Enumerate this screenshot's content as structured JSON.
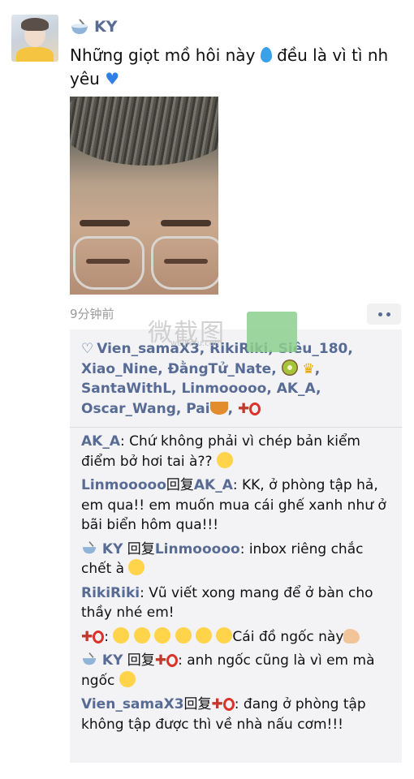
{
  "post": {
    "author": "KY",
    "text_before_drop": "Những giọt mồ hôi này ",
    "text_after_drop": " đều là vì tì nh yêu ",
    "time": "9分钟前"
  },
  "likes": {
    "names": [
      "Vien_samaX3",
      "RikiRiki",
      "Siêu_180",
      "Xiao_Nine",
      "ĐằngTử_Nate",
      "SantaWithL",
      "Linmooooo",
      "AK_A",
      "Oscar_Wang",
      "Pai"
    ],
    "separator": ",  "
  },
  "comments": [
    {
      "name": "AK_A",
      "reply_word": "",
      "reply_to": "",
      "text": ": Chứ không phải vì chép bản kiểm điểm bở hơi tai à?? "
    },
    {
      "name": "Linmooooo",
      "reply_word": "回复",
      "reply_to": "AK_A",
      "text": ": KK, ở phòng tập hả, em qua!! em muốn mua cái ghế xanh như ở bãi biển hôm qua!!!"
    },
    {
      "name": "KY",
      "reply_word": " 回复",
      "reply_to": "Linmooooo",
      "text": ": inbox riêng chắc chết à "
    },
    {
      "name": "RikiRiki",
      "reply_word": "",
      "reply_to": "",
      "text": ": Vũ viết xong mang để ở bàn cho thầy nhé em!"
    },
    {
      "name": "",
      "reply_word": "",
      "reply_to": "",
      "text": "Cái đồ ngốc này"
    },
    {
      "name": "KY",
      "reply_word": " 回复",
      "reply_to": "",
      "text": ": anh ngốc cũng là vì em mà ngốc "
    },
    {
      "name": "Vien_samaX3",
      "reply_word": "回复",
      "reply_to": "",
      "text": ": đang ở phòng tập không tập được thì về nhà nấu cơm!!!"
    }
  ],
  "watermark": {
    "text": "微截图",
    "url": "weijietu.com"
  },
  "colors": {
    "link": "#576b95",
    "panel": "#f3f3f5",
    "time": "#9a9a9a"
  }
}
